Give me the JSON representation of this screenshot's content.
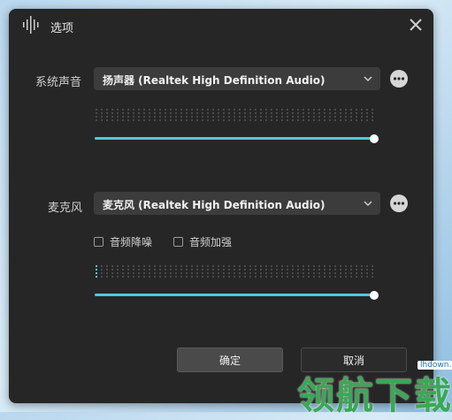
{
  "window": {
    "title": "选项"
  },
  "system_sound": {
    "label": "系统声音",
    "device": "扬声器 (Realtek High Definition Audio)",
    "meter_level": 0.0,
    "volume": 1.0
  },
  "microphone": {
    "label": "麦克风",
    "device": "麦克风 (Realtek High Definition Audio)",
    "noise_reduction": {
      "label": "音频降噪",
      "checked": false
    },
    "boost": {
      "label": "音频加强",
      "checked": false
    },
    "meter_level": 0.02,
    "volume": 1.0
  },
  "buttons": {
    "ok": "确定",
    "cancel": "取消"
  },
  "watermark": {
    "text": "领航下载",
    "url": "lhdown.com"
  },
  "colors": {
    "accent": "#53c6e3",
    "dialog_bg": "#262626",
    "watermark_green": "#3aa856"
  },
  "icons": {
    "app": "audio-wave-icon",
    "close": "close-icon",
    "more": "more-dots-icon",
    "dropdown": "chevron-down-icon"
  }
}
